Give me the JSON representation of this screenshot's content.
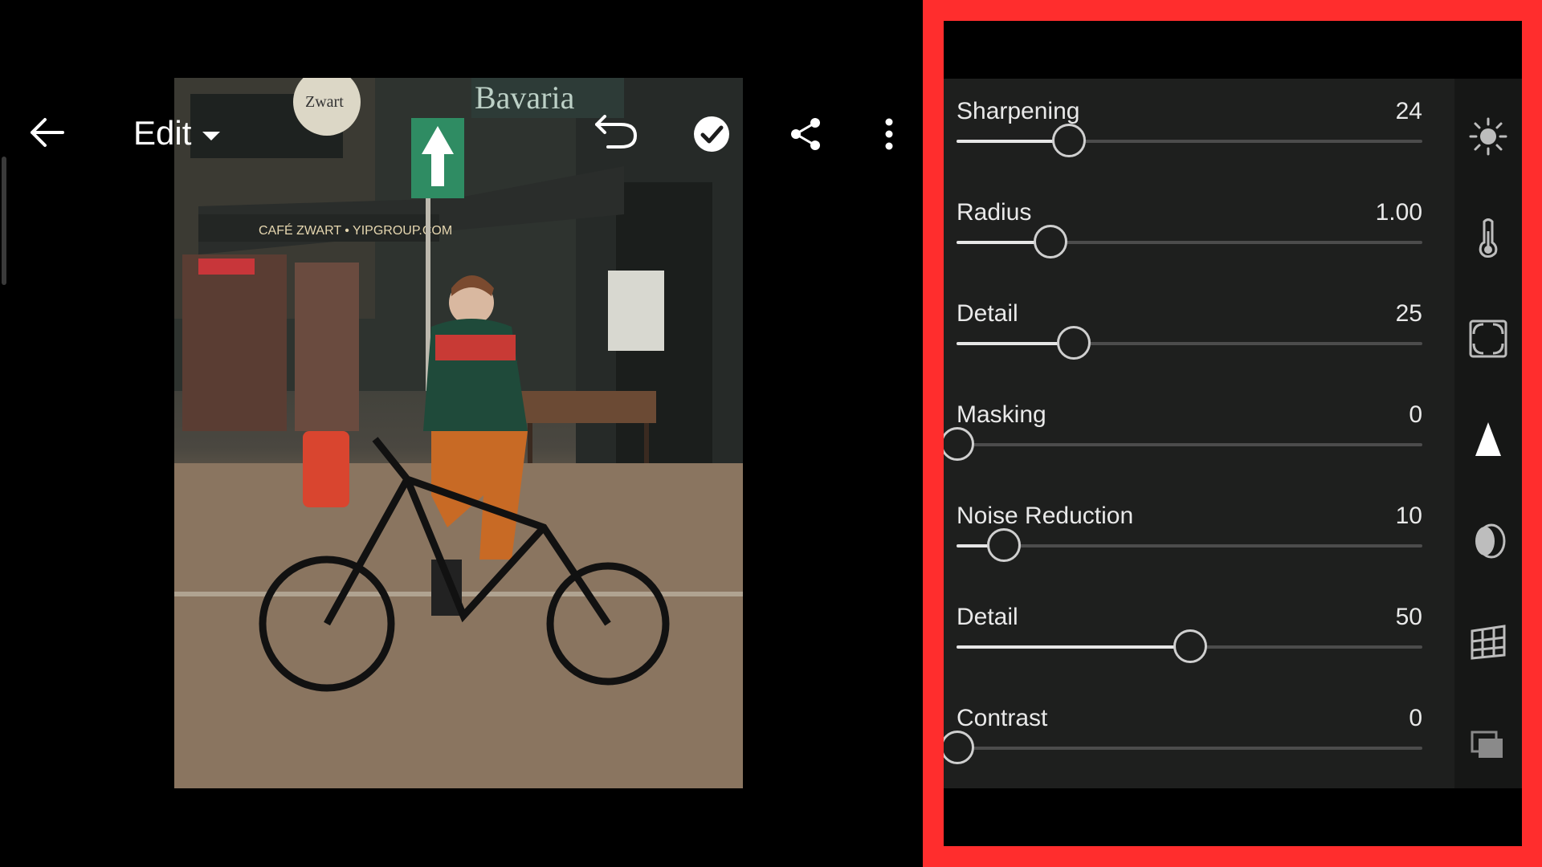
{
  "toolbar": {
    "edit_label": "Edit",
    "icons": [
      "back-arrow-icon",
      "chevron-down-icon",
      "undo-icon",
      "checkmark-icon",
      "share-icon",
      "more-vertical-icon"
    ]
  },
  "photo": {
    "signs": [
      "Bavaria",
      "CAFÉ ZWART • YIPGROUP.COM",
      "Zwart"
    ]
  },
  "detail_panel": {
    "sliders": [
      {
        "label": "Sharpening",
        "value": "24",
        "level": 0.24
      },
      {
        "label": "Radius",
        "value": "1.00",
        "level": 0.2
      },
      {
        "label": "Detail",
        "value": "25",
        "level": 0.25
      },
      {
        "label": "Masking",
        "value": "0",
        "level": 0
      },
      {
        "label": "Noise Reduction",
        "value": "10",
        "level": 0.1
      },
      {
        "label": "Detail",
        "value": "50",
        "level": 0.5
      },
      {
        "label": "Contrast",
        "value": "0",
        "level": 0
      }
    ],
    "tools": [
      "light-icon",
      "color-temperature-icon",
      "effects-icon",
      "detail-icon",
      "optics-icon",
      "geometry-icon",
      "presets-icon"
    ],
    "active_tool": "detail-icon"
  },
  "colors": {
    "highlight_frame": "#ff2d2d",
    "panel_bg": "#1e1f1e",
    "rail_bg": "#161716"
  }
}
